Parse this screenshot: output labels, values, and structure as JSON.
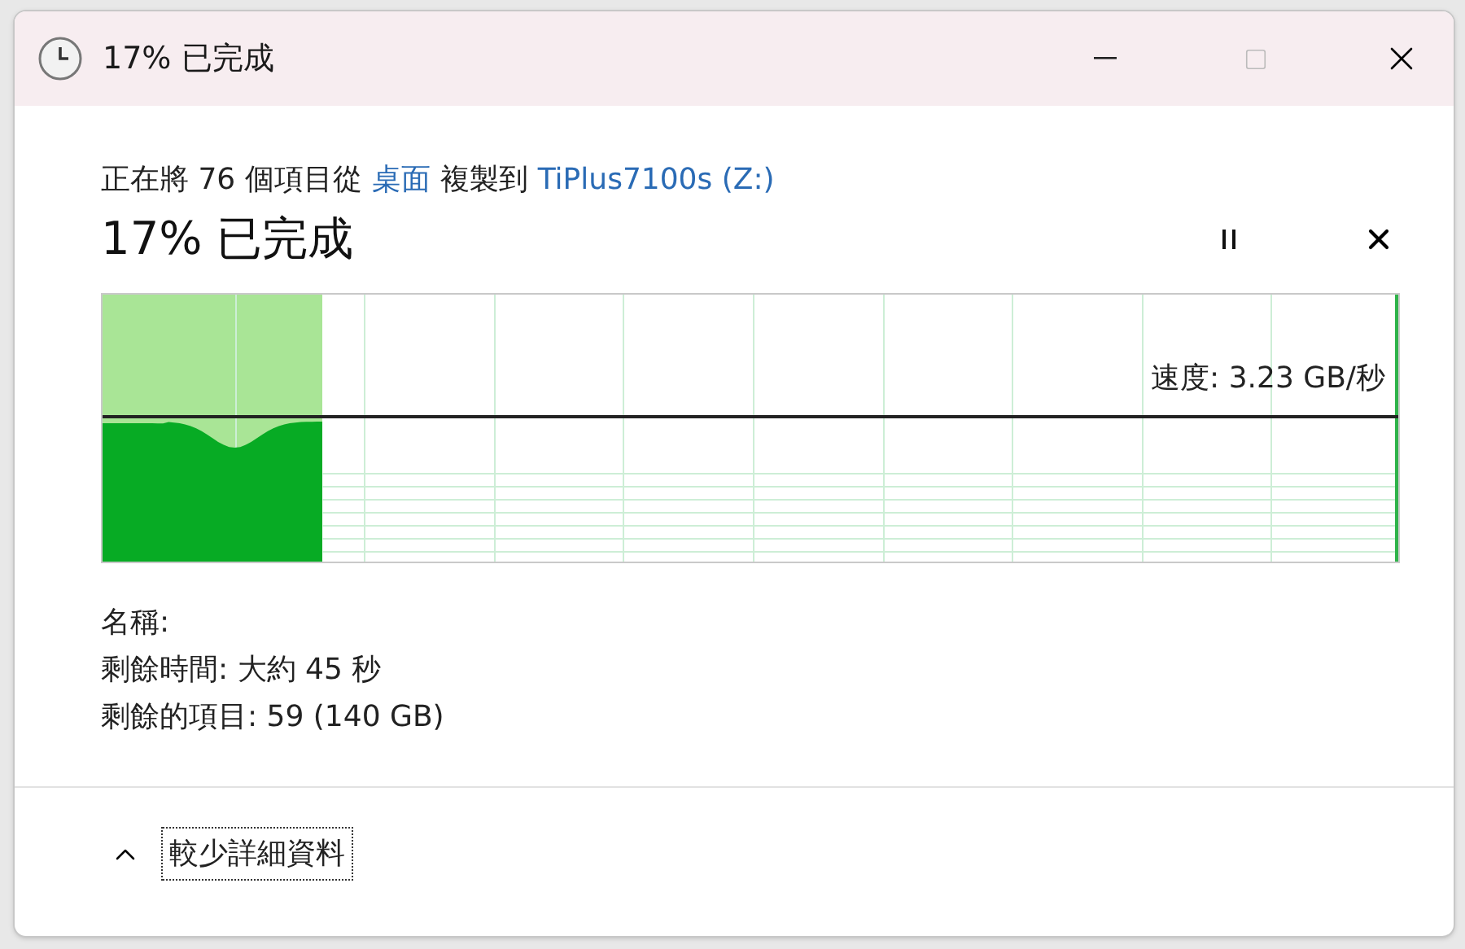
{
  "window": {
    "title": "17% 已完成"
  },
  "status": [
    {
      "kind": "plain",
      "text": "正在將 76 個項目從"
    },
    {
      "kind": "link",
      "text": "桌面"
    },
    {
      "kind": "plain",
      "text": "複製到"
    },
    {
      "kind": "link",
      "text": "TiPlus7100s (Z:)"
    }
  ],
  "heading": "17% 已完成",
  "progress": {
    "level": 0.17,
    "speed": "速度: 3.23 GB/秒"
  },
  "details": [
    "名稱:",
    "剩餘時間: 大約 45 秒",
    "剩餘的項目: 59 (140 GB)"
  ],
  "toggle": {
    "label": "較少詳細資料",
    "expanded": true
  }
}
